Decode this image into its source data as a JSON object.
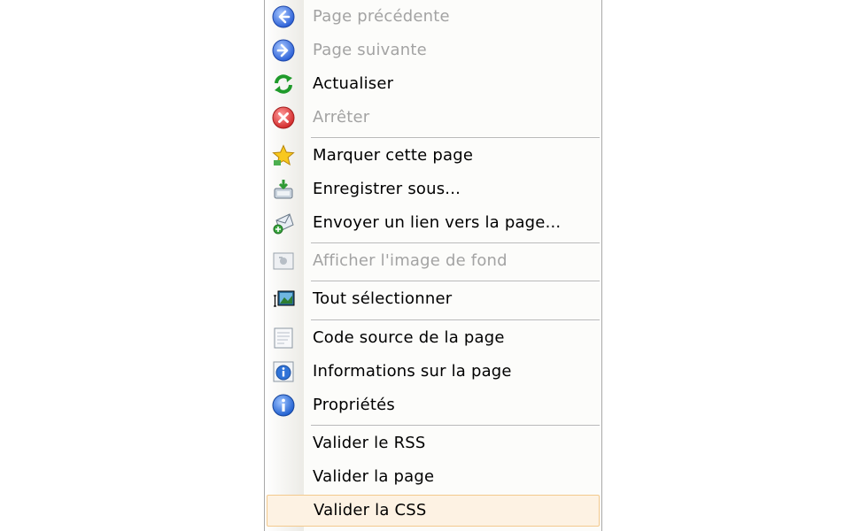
{
  "menu": {
    "items": [
      {
        "label": "Page précédente",
        "icon": "back-arrow-icon",
        "disabled": true
      },
      {
        "label": "Page suivante",
        "icon": "forward-arrow-icon",
        "disabled": true
      },
      {
        "label": "Actualiser",
        "icon": "refresh-icon",
        "disabled": false
      },
      {
        "label": "Arrêter",
        "icon": "stop-icon",
        "disabled": true
      },
      {
        "label": "Marquer cette page",
        "icon": "bookmark-star-icon",
        "disabled": false
      },
      {
        "label": "Enregistrer sous...",
        "icon": "save-icon",
        "disabled": false
      },
      {
        "label": "Envoyer un lien vers la page...",
        "icon": "send-link-icon",
        "disabled": false
      },
      {
        "label": "Afficher l'image de fond",
        "icon": "background-image-icon",
        "disabled": true
      },
      {
        "label": "Tout sélectionner",
        "icon": "select-all-icon",
        "disabled": false
      },
      {
        "label": "Code source de la page",
        "icon": "page-source-icon",
        "disabled": false
      },
      {
        "label": "Informations sur la page",
        "icon": "page-info-icon",
        "disabled": false
      },
      {
        "label": "Propriétés",
        "icon": "properties-icon",
        "disabled": false
      },
      {
        "label": "Valider le RSS",
        "icon": "",
        "disabled": false
      },
      {
        "label": "Valider la page",
        "icon": "",
        "disabled": false
      },
      {
        "label": "Valider la CSS",
        "icon": "",
        "disabled": false,
        "highlighted": true
      }
    ]
  },
  "colors": {
    "disabled_text": "#a3a3a3",
    "highlight_bg": "#fdf2e3",
    "highlight_border": "#f3c98d"
  }
}
